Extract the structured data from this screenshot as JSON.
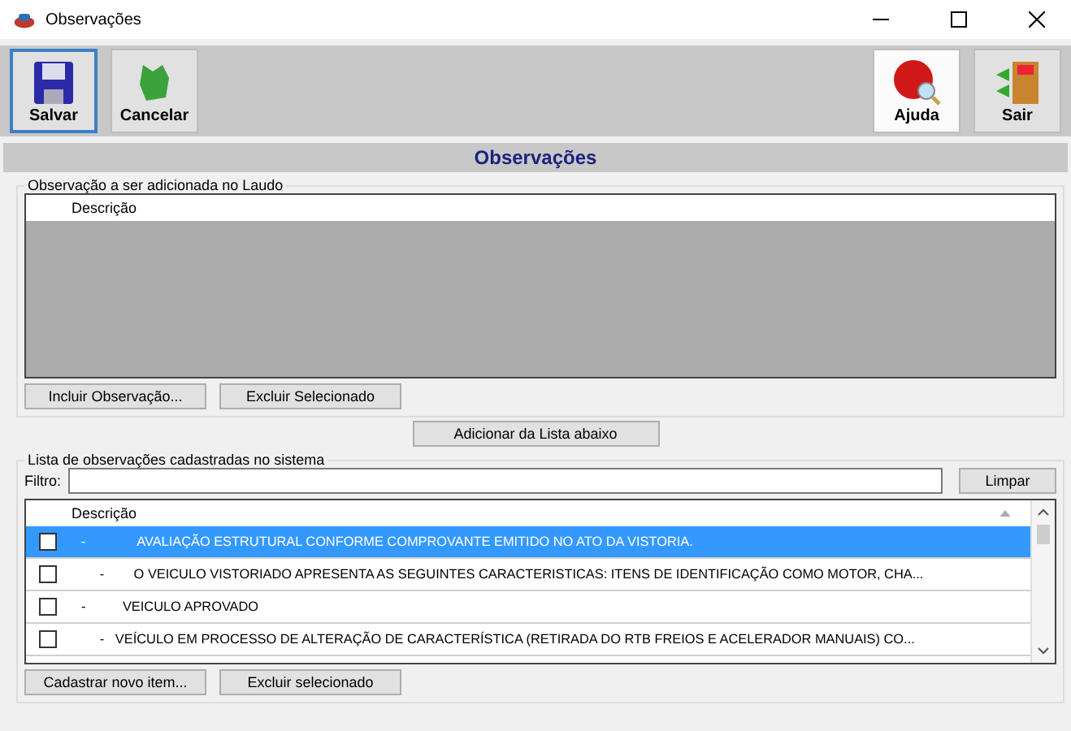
{
  "window": {
    "title": "Observações"
  },
  "toolbar": [
    {
      "label": "Salvar",
      "kind": "save",
      "selected": true
    },
    {
      "label": "Cancelar",
      "kind": "cancel",
      "selected": false
    },
    {
      "label": "Ajuda",
      "kind": "help",
      "selected": false
    },
    {
      "label": "Sair",
      "kind": "exit",
      "selected": false
    }
  ],
  "header": "Observações",
  "report_group": {
    "title": "Observação a ser adicionada no Laudo",
    "columns": [
      "Descrição"
    ],
    "buttons": [
      "Incluir Observação...",
      "Excluir Selecionado"
    ]
  },
  "add_button": "Adicionar da Lista abaixo",
  "registered_group": {
    "title": "Lista de observações cadastradas no sistema",
    "filter_label": "Filtro:",
    "clear_button": "Limpar",
    "columns": [
      "Descrição"
    ],
    "rows": [
      {
        "checked": false,
        "selected": true,
        "text": "-              AVALIAÇÃO ESTRUTURAL CONFORME COMPROVANTE EMITIDO NO ATO DA VISTORIA."
      },
      {
        "checked": false,
        "selected": false,
        "text": "     -        O VEICULO VISTORIADO APRESENTA AS SEGUINTES CARACTERISTICAS: ITENS DE IDENTIFICAÇÃO COMO MOTOR, CHA..."
      },
      {
        "checked": false,
        "selected": false,
        "text": "-          VEICULO APROVADO"
      },
      {
        "checked": false,
        "selected": false,
        "text": "     -   VEÍCULO EM PROCESSO DE ALTERAÇÃO DE CARACTERÍSTICA (RETIRADA DO RTB FREIOS E ACELERADOR MANUAIS) CO..."
      }
    ],
    "buttons": [
      "Cadastrar novo item...",
      "Excluir selecionado"
    ]
  }
}
